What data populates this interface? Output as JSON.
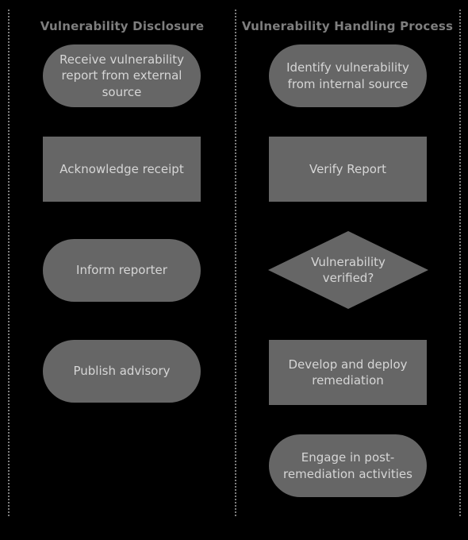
{
  "diagram": {
    "type": "swimlane-flowchart",
    "background_color": "#000000",
    "node_fill_color": "#666666",
    "node_text_color": "#d6d6d6",
    "title_color": "#7e7e7e",
    "divider_color": "#7d7d7d"
  },
  "lanes": [
    {
      "id": "vulnerability-disclosure",
      "title": "Vulnerability Disclosure",
      "nodes": [
        {
          "id": "receive-report",
          "shape": "stadium",
          "label": "Receive vulnerability report from external source"
        },
        {
          "id": "acknowledge-receipt",
          "shape": "rect",
          "label": "Acknowledge receipt"
        },
        {
          "id": "inform-reporter",
          "shape": "stadium",
          "label": "Inform reporter"
        },
        {
          "id": "publish-advisory",
          "shape": "stadium",
          "label": "Publish advisory"
        }
      ]
    },
    {
      "id": "vulnerability-handling-process",
      "title": "Vulnerability Handling Process",
      "nodes": [
        {
          "id": "identify-vulnerability",
          "shape": "stadium",
          "label": "Identify vulnerability from internal source"
        },
        {
          "id": "verify-report",
          "shape": "rect",
          "label": "Verify Report"
        },
        {
          "id": "vulnerability-verified",
          "shape": "diamond",
          "label": "Vulnerability verified?"
        },
        {
          "id": "develop-deploy-remediation",
          "shape": "rect",
          "label": "Develop and deploy remediation"
        },
        {
          "id": "engage-post-remediation",
          "shape": "stadium",
          "label": "Engage in post-remediation activities"
        }
      ]
    }
  ]
}
